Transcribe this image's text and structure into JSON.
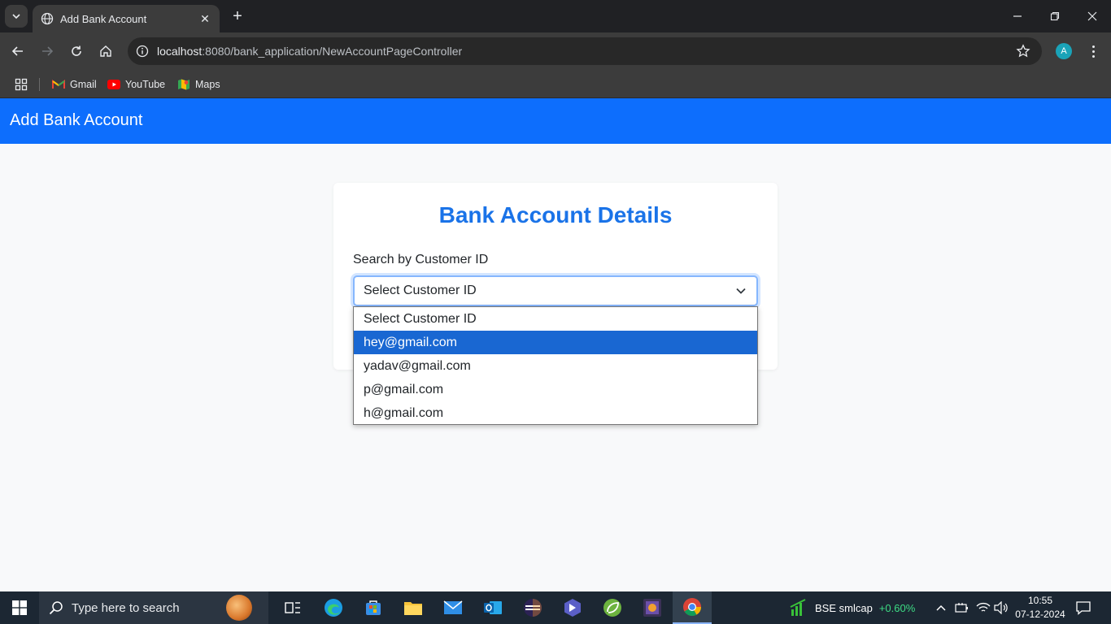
{
  "browser": {
    "tab_title": "Add Bank Account",
    "url_host": "localhost",
    "url_path": ":8080/bank_application/NewAccountPageController",
    "profile_initial": "A",
    "bookmarks": [
      {
        "label": "Gmail",
        "icon": "gmail-icon"
      },
      {
        "label": "YouTube",
        "icon": "youtube-icon"
      },
      {
        "label": "Maps",
        "icon": "maps-icon"
      }
    ]
  },
  "header": {
    "title": "Add Bank Account",
    "color": "#0d6efd"
  },
  "card": {
    "title": "Bank Account Details",
    "search_label": "Search by Customer ID",
    "select_value": "Select Customer ID"
  },
  "dropdown": {
    "options": [
      {
        "label": "Select Customer ID",
        "selected": false
      },
      {
        "label": "hey@gmail.com",
        "selected": true
      },
      {
        "label": "yadav@gmail.com",
        "selected": false
      },
      {
        "label": "p@gmail.com",
        "selected": false
      },
      {
        "label": "h@gmail.com",
        "selected": false
      }
    ]
  },
  "taskbar": {
    "search_placeholder": "Type here to search",
    "stock_name": "BSE smlcap",
    "stock_change": "+0.60%",
    "time": "10:55",
    "date": "07-12-2024"
  }
}
